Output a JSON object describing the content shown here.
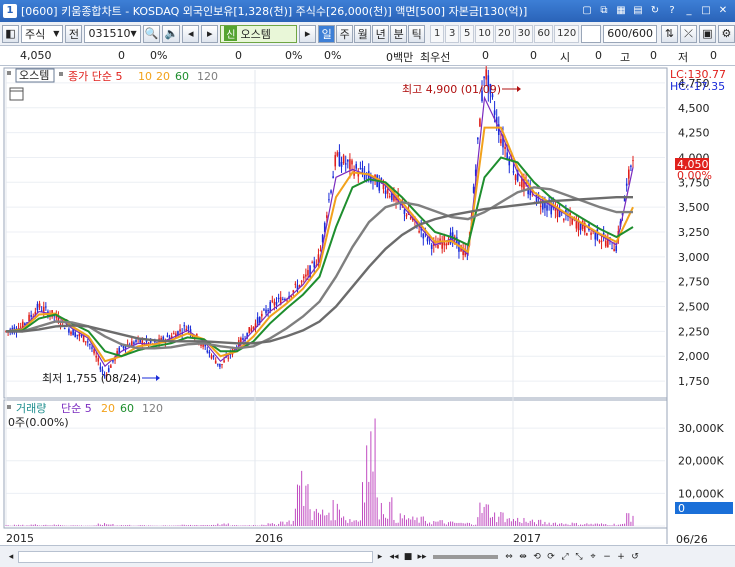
{
  "titlebar": {
    "window_num": "1",
    "text": "[0600] 키움종합차트 - KOSDAQ 외국인보유[1,328(천)] 주식수[26,000(천)] 액면[500] 자본금[130(억)]"
  },
  "toolbar": {
    "market": "주식",
    "all_label": "전",
    "code": "031510",
    "credit_badge": "신",
    "stock_name": "오스템",
    "periods": [
      "일",
      "주",
      "월",
      "년",
      "분",
      "틱"
    ],
    "active_period": "일",
    "intervals": [
      "1",
      "3",
      "5",
      "10",
      "20",
      "30",
      "60",
      "120"
    ],
    "count_value": "600/600"
  },
  "quote": {
    "price": "4,050",
    "change": "0",
    "change_pct": "0%",
    "volume": "0",
    "vol_pct": "0%",
    "v2_pct": "0%",
    "amount": "0백만",
    "rank_label": "최우선",
    "rank_val": "0",
    "open_label": "시",
    "open_val": "0",
    "high_label": "고",
    "high_val": "0",
    "low_label": "저",
    "low_val": "0"
  },
  "colors": {
    "candle_up": "#e0201c",
    "candle_down": "#1a2bd8",
    "ma5": "#7a2bbf",
    "ma10": "#f2a21c",
    "ma20": "#1e8e2e",
    "ma60": "#7f7f7f",
    "vol_bar": "#c04bc0"
  },
  "price_panel": {
    "name_label": "오스템",
    "ma_label": "종가 단순 5",
    "ma_periods": [
      "10",
      "20",
      "60",
      "120"
    ],
    "high_marker": "최고 4,900 (01/09)",
    "low_marker": "최저 1,755 (08/24)",
    "lc_label": "LC:130.77",
    "hc_label": "HC:-17.35",
    "current_price": "4,050",
    "current_pct": "0.00%"
  },
  "volume_panel": {
    "name_label": "거래량",
    "ma_label": "단순 5",
    "ma_periods": [
      "20",
      "60",
      "120"
    ],
    "current_label": "0주(0.00%)",
    "current_value": "0"
  },
  "x_axis": {
    "labels": [
      "2015",
      "2016",
      "2017"
    ],
    "right_label": "06/26"
  },
  "chart_data": [
    {
      "type": "line",
      "title": "",
      "ylim": [
        1600,
        4880
      ],
      "yticks": [
        "4,750",
        "4,500",
        "4,250",
        "4,000",
        "3,750",
        "3,500",
        "3,250",
        "3,000",
        "2,750",
        "2,500",
        "2,250",
        "2,000",
        "1,750"
      ],
      "x": [
        "2015",
        "2016",
        "2017"
      ],
      "series": [
        {
          "name": "종가",
          "values": [
            2250,
            2300,
            2500,
            2400,
            2250,
            2150,
            1800,
            2100,
            2150,
            2120,
            2200,
            2300,
            2100,
            1900,
            2100,
            2300,
            2500,
            2600,
            2750,
            3000,
            4000,
            3900,
            3800,
            3700,
            3500,
            3300,
            3100,
            3200,
            3000,
            4900,
            4200,
            3800,
            3600,
            3500,
            3400,
            3300,
            3200,
            3100,
            4050
          ]
        },
        {
          "name": "5",
          "values": [
            2250,
            2280,
            2450,
            2420,
            2280,
            2180,
            1900,
            2050,
            2130,
            2120,
            2180,
            2260,
            2150,
            1950,
            2080,
            2260,
            2450,
            2570,
            2720,
            2950,
            3800,
            3880,
            3820,
            3720,
            3520,
            3320,
            3120,
            3180,
            3020,
            4600,
            4250,
            3850,
            3620,
            3520,
            3420,
            3320,
            3220,
            3120,
            3900
          ]
        },
        {
          "name": "10",
          "values": [
            2250,
            2270,
            2420,
            2430,
            2300,
            2200,
            1950,
            2000,
            2100,
            2120,
            2160,
            2230,
            2170,
            2000,
            2050,
            2200,
            2400,
            2530,
            2680,
            2900,
            3600,
            3850,
            3830,
            3740,
            3550,
            3350,
            3150,
            3160,
            3050,
            4300,
            4300,
            3900,
            3650,
            3540,
            3430,
            3330,
            3230,
            3150,
            3500
          ]
        },
        {
          "name": "20",
          "values": [
            2250,
            2260,
            2380,
            2420,
            2330,
            2250,
            2050,
            2000,
            2060,
            2100,
            2130,
            2190,
            2170,
            2050,
            2050,
            2150,
            2330,
            2480,
            2620,
            2800,
            3300,
            3700,
            3780,
            3750,
            3600,
            3420,
            3250,
            3200,
            3120,
            3800,
            4000,
            3950,
            3750,
            3600,
            3480,
            3380,
            3280,
            3200,
            3300
          ]
        },
        {
          "name": "60",
          "values": [
            2250,
            2250,
            2300,
            2350,
            2340,
            2300,
            2200,
            2120,
            2080,
            2080,
            2090,
            2120,
            2130,
            2100,
            2080,
            2100,
            2180,
            2280,
            2400,
            2550,
            2800,
            3100,
            3350,
            3500,
            3550,
            3520,
            3460,
            3400,
            3380,
            3450,
            3550,
            3650,
            3700,
            3680,
            3620,
            3560,
            3500,
            3450,
            3450
          ]
        },
        {
          "name": "120",
          "values": [
            2250,
            2250,
            2270,
            2300,
            2310,
            2300,
            2260,
            2220,
            2180,
            2160,
            2150,
            2150,
            2150,
            2140,
            2130,
            2130,
            2150,
            2200,
            2260,
            2350,
            2500,
            2700,
            2900,
            3080,
            3220,
            3320,
            3380,
            3420,
            3450,
            3480,
            3500,
            3520,
            3540,
            3560,
            3570,
            3580,
            3590,
            3600,
            3600
          ]
        }
      ]
    },
    {
      "type": "bar",
      "title": "",
      "ylim": [
        0,
        38000
      ],
      "yticks": [
        "30,000K",
        "20,000K",
        "10,000K",
        "0"
      ],
      "series": [
        {
          "name": "거래량",
          "values": [
            300,
            400,
            600,
            500,
            300,
            200,
            900,
            400,
            300,
            200,
            300,
            400,
            500,
            800,
            300,
            400,
            900,
            2000,
            18000,
            6000,
            8000,
            3000,
            35000,
            9000,
            4000,
            3000,
            2000,
            1500,
            1200,
            8000,
            5000,
            3000,
            2000,
            1500,
            1200,
            1000,
            900,
            800,
            6000
          ]
        }
      ]
    }
  ]
}
